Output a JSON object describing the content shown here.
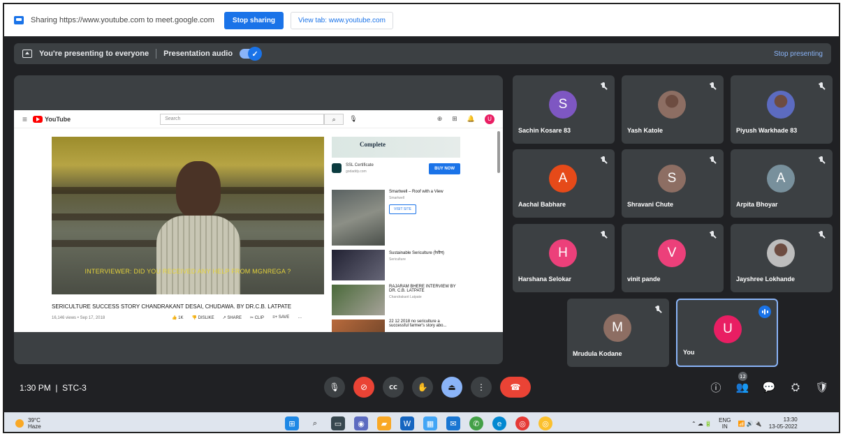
{
  "share_bar": {
    "text": "Sharing https://www.youtube.com to meet.google.com",
    "stop_sharing": "Stop sharing",
    "view_tab": "View tab: www.youtube.com"
  },
  "present_bar": {
    "text": "You're presenting to everyone",
    "audio_label": "Presentation audio",
    "audio_check": "✓",
    "stop_presenting": "Stop presenting"
  },
  "youtube": {
    "hamburger": "≡",
    "logo": "YouTube",
    "search_placeholder": "Search",
    "search_icon": "⌕",
    "mic_icon": "🎙",
    "create_icon": "⊕",
    "apps_icon": "⊞",
    "bell_icon": "🔔",
    "avatar_letter": "U",
    "subtitle": "INTERVIEWER: DID YOU RECEIVED ANY HELP FROM MGNREGA ?",
    "video_title": "SERICULTURE SUCCESS STORY CHANDRAKANT DESAI, CHUDAWA. BY DR.C.B. LATPATE",
    "video_meta": "16,146 views • Sep 17, 2018",
    "actions": [
      "👍 1K",
      "👎 DISLIKE",
      "↗ SHARE",
      "✂ CLIP",
      "≡+ SAVE",
      "…"
    ],
    "ad_banner": "Complete",
    "ad_title": "SSL Certificate",
    "ad_domain": "godaddy.com",
    "buy_now": "BUY NOW",
    "side_items": [
      {
        "title": "Smartwell – Roof with a View",
        "sub": "Smartwell"
      },
      {
        "title": "Sustainable Sericulture (रेशीम)",
        "sub": "Sericulture"
      },
      {
        "title": "RAJARAM BHERE INTERVIEW BY DR. C.B. LATPATE",
        "sub": "Chandrakant Latpate"
      },
      {
        "title": "22 12 2018 no sericulture a successful farmer's story abo...",
        "sub": ""
      }
    ],
    "visit_site": "VISIT SITE"
  },
  "participants": [
    {
      "name": "Sachin Kosare 83",
      "initial": "S",
      "color": "#7e57c2",
      "muted": true
    },
    {
      "name": "Yash Katole",
      "initial": "",
      "color": "#8d6e63",
      "muted": true,
      "photo": true
    },
    {
      "name": "Piyush Warkhade 83",
      "initial": "",
      "color": "#5c6bc0",
      "muted": true,
      "photo": true
    },
    {
      "name": "Aachal Babhare",
      "initial": "A",
      "color": "#e64a19",
      "muted": true
    },
    {
      "name": "Shravani Chute",
      "initial": "S",
      "color": "#8d6e63",
      "muted": true
    },
    {
      "name": "Arpita Bhoyar",
      "initial": "A",
      "color": "#78909c",
      "muted": true
    },
    {
      "name": "Harshana Selokar",
      "initial": "H",
      "color": "#ec407a",
      "muted": true
    },
    {
      "name": "vinit pande",
      "initial": "V",
      "color": "#ec407a",
      "muted": true
    },
    {
      "name": "Jayshree Lokhande",
      "initial": "",
      "color": "#bdbdbd",
      "muted": true,
      "photo": true
    },
    {
      "name": "Mrudula Kodane",
      "initial": "M",
      "color": "#8d6e63",
      "muted": true
    },
    {
      "name": "You",
      "initial": "U",
      "color": "#e91e63",
      "muted": false
    }
  ],
  "bottom": {
    "time_room": "1:30 PM  |  STC-3",
    "controls": {
      "mic": "🎙",
      "camera": "⊘",
      "captions": "CC",
      "hand": "✋",
      "present": "⏏",
      "more": "⋮",
      "hangup": "☎"
    },
    "right": {
      "info": "ⓘ",
      "people": "👥",
      "people_count": "12",
      "chat": "💬",
      "activities": "⛭",
      "host": "🛡"
    }
  },
  "taskbar": {
    "temp": "39°C",
    "weather": "Haze",
    "lang": "ENG",
    "region": "IN",
    "time": "13:30",
    "date": "13-05-2022",
    "tray_icons": "⌃ ☁ 🔋",
    "net_icons": "📶 🔊 🔌"
  }
}
